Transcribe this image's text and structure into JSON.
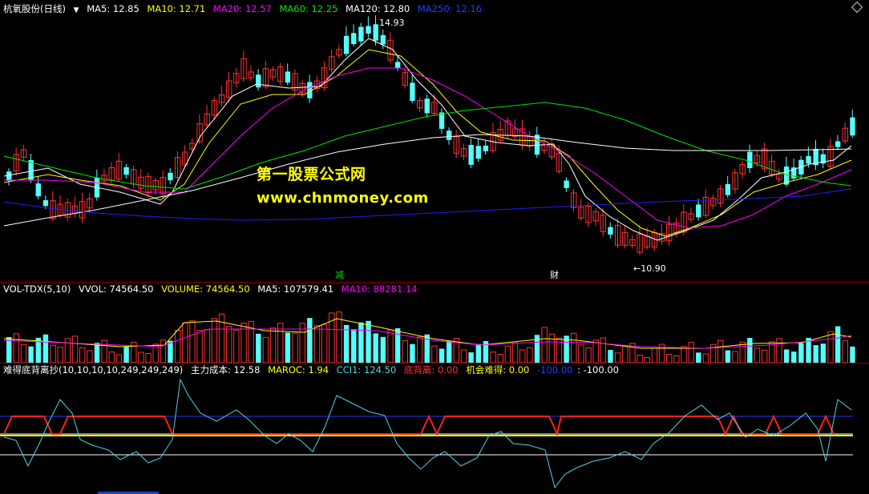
{
  "main_header": {
    "stock_name": "杭氧股份(日线)",
    "ma5": "MA5: 12.85",
    "ma10": "MA10: 12.71",
    "ma20": "MA20: 12.57",
    "ma60": "MA60: 12.25",
    "ma120": "MA120: 12.80",
    "ma250": "MA250: 12.16"
  },
  "annotations": {
    "high_label": "14.93",
    "low_label": "←10.90",
    "marker_reduce": "减",
    "marker_finance": "财"
  },
  "watermark": {
    "line1": "第一股票公式网",
    "line2": "www.chnmoney.com"
  },
  "volume_header": {
    "indicator": "VOL-TDX(5,10)",
    "vvol": "VVOL: 74564.50",
    "volume": "VOLUME: 74564.50",
    "ma5": "MA5: 107579.41",
    "ma10": "MA10: 88281.14"
  },
  "indicator_header": {
    "name": "难得底背离抄(10,10,10,10,249,249,249)",
    "main_cost": "主力成本: 12.58",
    "maroc": "MAROC: 1.94",
    "cci1": "CCI1: 124.50",
    "bottom_divergence": "底背离: 0.00",
    "opportunity": "机会难得: 0.00",
    "minus_label": "-100.00",
    "minus_value": ": -100.00"
  },
  "colors": {
    "up": "#ff3232",
    "down": "#54ffff",
    "ma5": "#ffffff",
    "ma10": "#ffff00",
    "ma20": "#ff00ff",
    "ma60": "#00e600",
    "ma120": "#ffffff",
    "ma250": "#2020ff",
    "header_ma5": "#ffffff",
    "header_ma10": "#ffff00",
    "header_ma20": "#ff00ff",
    "header_ma60": "#00e600",
    "header_ma120": "#ffffff",
    "header_ma250": "#1f3fff",
    "cyan_line": "#4fd3e8",
    "separator": "#8b0000"
  }
}
